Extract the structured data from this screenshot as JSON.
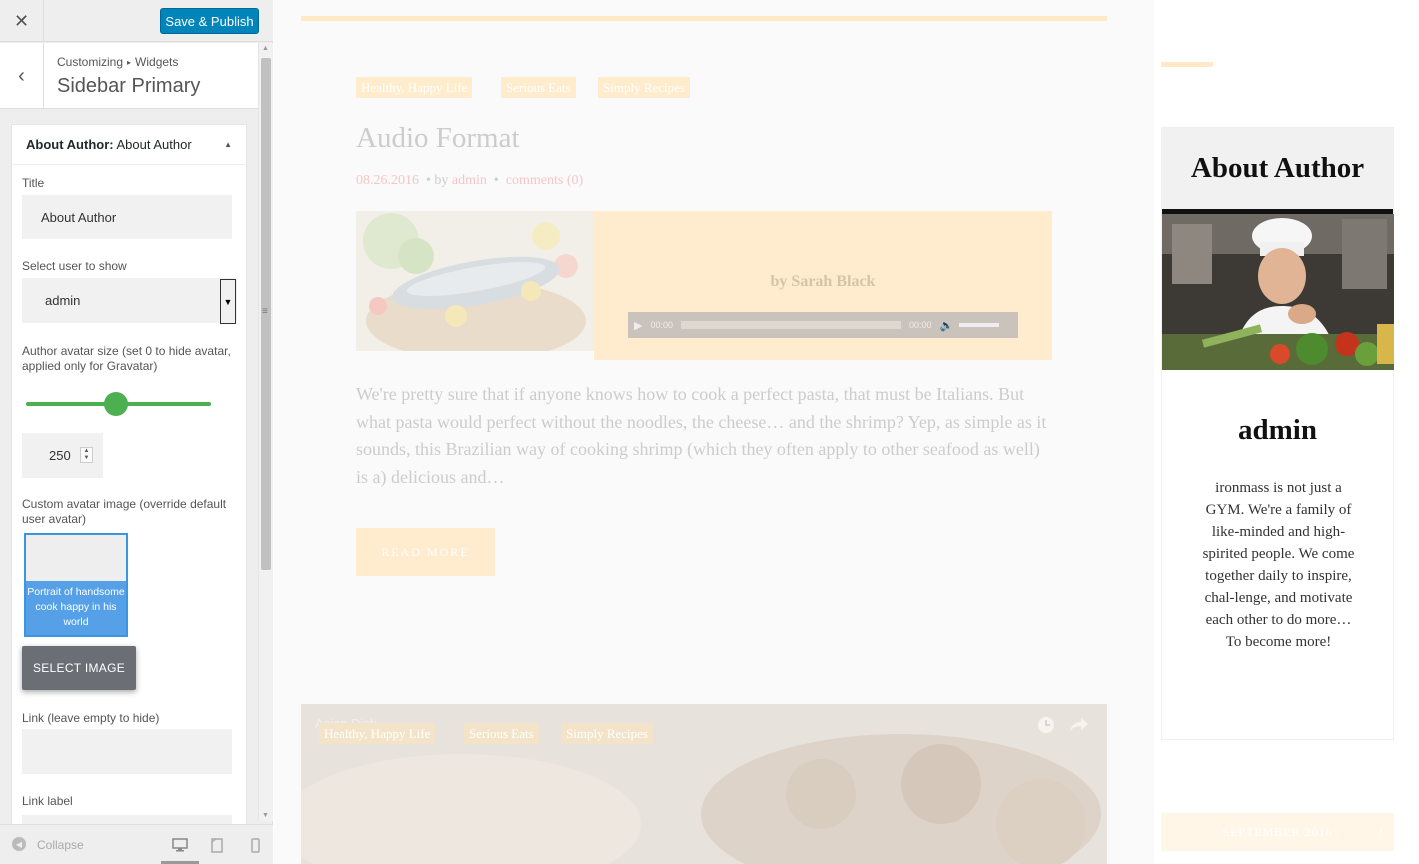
{
  "header": {
    "close_icon": "close-icon",
    "publish_label": "Save & Publish",
    "accent": "#0085ba"
  },
  "section": {
    "crumb_1": "Customizing",
    "crumb_2": "Widgets",
    "title": "Sidebar Primary"
  },
  "widget": {
    "type_label": "About Author:",
    "instance_label": "About Author",
    "title_label": "Title",
    "title_value": "About Author",
    "user_label": "Select user to show",
    "user_value": "admin",
    "avatar_size_label": "Author avatar size (set 0 to hide avatar, applied only for Gravatar)",
    "avatar_size_value": "250",
    "avatar_size_fraction": 0.5,
    "custom_avatar_label": "Custom avatar image (override default user avatar)",
    "avatar_caption": "Portrait of handsome cook happy in his world",
    "select_image_label": "SELECT IMAGE",
    "link_label": "Link (leave empty to hide)",
    "link_text_label": "Link label",
    "slider_color": "#4caf50"
  },
  "footer": {
    "collapse_label": "Collapse"
  },
  "preview": {
    "categories": [
      "Healthy, Happy Life",
      "Serious Eats",
      "Simply Recipes"
    ],
    "post_title": "Audio Format",
    "post_date": "08.26.2016",
    "post_by": "• by",
    "post_author": "admin",
    "post_comments": "comments (0)",
    "audio_byline": "by Sarah Black",
    "audio_time_start": "00:00",
    "audio_time_end": "00:00",
    "excerpt": "We're pretty sure that if anyone knows how to cook a perfect pasta, that must be Italians. But what pasta would perfect without the noodles, the cheese… and the shrimp? Yep, as simple as it sounds, this Brazilian way of cooking shrimp (which they often apply to other seafood as well) is a) delicious and…",
    "read_more": "READ MORE",
    "video_title": "Asian Dish",
    "video_categories": [
      "Healthy, Happy Life",
      "Serious Eats",
      "Simply Recipes"
    ]
  },
  "sidebar": {
    "widget_title": "About Author",
    "author_name": "admin",
    "author_bio": "ironmass is not just a GYM. We're a family of like-minded and high-spirited people. We come together daily to inspire, chal-lenge, and motivate each other to do more… To become more!",
    "calendar_label": "SEPTEMBER 2016"
  }
}
